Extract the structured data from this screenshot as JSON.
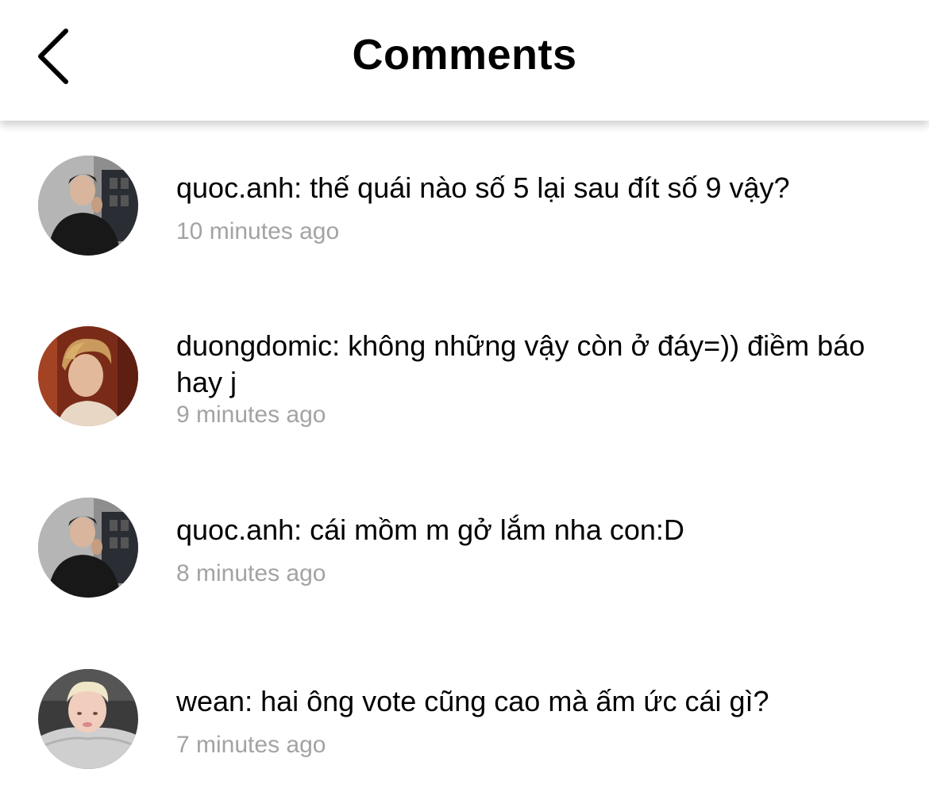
{
  "header": {
    "title": "Comments",
    "back_icon": "chevron-left-icon"
  },
  "comments": [
    {
      "username": "quoc.anh",
      "text": "quoc.anh: thế quái nào số 5 lại sau đít số 9 vậy?",
      "time": "10 minutes ago",
      "avatar_icon": "avatar-photo"
    },
    {
      "username": "duongdomic",
      "text": "duongdomic: không những vậy còn ở đáy=)) điềm báo hay j",
      "time": "9 minutes ago",
      "avatar_icon": "avatar-photo"
    },
    {
      "username": "quoc.anh",
      "text": "quoc.anh: cái mồm m gở lắm nha con:D",
      "time": "8 minutes ago",
      "avatar_icon": "avatar-photo"
    },
    {
      "username": "wean",
      "text": "wean: hai ông vote cũng cao mà ấm ức cái gì?",
      "time": "7 minutes ago",
      "avatar_icon": "avatar-photo"
    }
  ],
  "colors": {
    "text": "#000000",
    "timestamp": "#a3a3a3",
    "background": "#ffffff"
  }
}
